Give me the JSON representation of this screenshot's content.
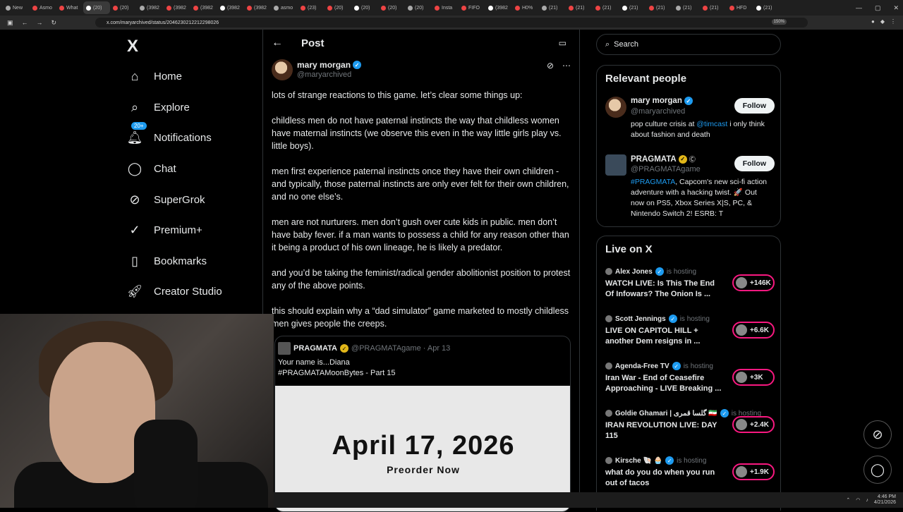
{
  "browser": {
    "tabs": [
      "New",
      "Asmo",
      "What",
      "(20)",
      "(20)",
      "(3982",
      "(3982",
      "(3982",
      "(3982",
      "(3982",
      "asmo",
      "(23)",
      "(20)",
      "(20)",
      "(20)",
      "(20)",
      "Insta",
      "FIFO",
      "(3982",
      "H0%",
      "(21)",
      "(21)",
      "(21)",
      "(21)",
      "(21)",
      "(21)",
      "(21)",
      "HFD",
      "(21)"
    ],
    "url": "x.com/maryarchived/status/2046230212212298026",
    "zoom": "150%",
    "clock_time": "4:46 PM",
    "clock_date": "4/21/2026"
  },
  "nav": {
    "logo": "X",
    "notifications_badge": "20+",
    "items": [
      {
        "label": "Home",
        "icon": "home-icon"
      },
      {
        "label": "Explore",
        "icon": "search-icon"
      },
      {
        "label": "Notifications",
        "icon": "bell-icon"
      },
      {
        "label": "Chat",
        "icon": "chat-icon"
      },
      {
        "label": "SuperGrok",
        "icon": "grok-icon"
      },
      {
        "label": "Premium+",
        "icon": "premium-icon"
      },
      {
        "label": "Bookmarks",
        "icon": "bookmark-icon"
      },
      {
        "label": "Creator Studio",
        "icon": "rocket-icon"
      }
    ]
  },
  "post": {
    "header_title": "Post",
    "author_name": "mary morgan",
    "author_handle": "@maryarchived",
    "paragraphs": [
      "lots of strange reactions to this game. let’s clear some things up:",
      "childless men do not have paternal instincts the way that childless women have maternal instincts (we observe this even in the way little girls play vs. little boys).",
      "men first experience paternal instincts once they have their own children - and typically, those paternal instincts are only ever felt for their own children, and no one else’s.",
      "men are not nurturers. men don’t gush over cute kids in public. men don’t have baby fever. if a man wants to possess a child for any reason other than it being a product of his own lineage, he is likely a predator.",
      "and you’d be taking the feminist/radical gender abolitionist position to protest any of the above points.",
      "this should explain why a “dad simulator” game marketed to mostly childless men gives people the creeps."
    ],
    "quote": {
      "name": "PRAGMATA",
      "handle": "@PRAGMATAgame · Apr 13",
      "text_line1": "Your name is...Diana",
      "text_line2": "#PRAGMATAMoonBytes - Part 15",
      "media_date": "April 17, 2026",
      "media_sub": "Preorder Now"
    }
  },
  "right": {
    "search_placeholder": "Search",
    "relevant_title": "Relevant people",
    "people": [
      {
        "name": "mary morgan",
        "handle": "@maryarchived",
        "bio_pre": "pop culture crisis at ",
        "bio_link": "@timcast",
        "bio_post": " i only think about fashion and death",
        "follow": "Follow"
      },
      {
        "name": "PRAGMATA",
        "handle": "@PRAGMATAgame",
        "bio_pre": "",
        "bio_link": "#PRAGMATA",
        "bio_post": ", Capcom's new sci-fi action adventure with a hacking twist. 🚀 Out now on PS5, Xbox Series X|S, PC, & Nintendo Switch 2! ESRB: T",
        "follow": "Follow"
      }
    ],
    "live_title": "Live on X",
    "live": [
      {
        "host": "Alex Jones",
        "status": "is hosting",
        "title": "WATCH LIVE: Is This The End Of Infowars? The Onion Is ...",
        "count": "+146K"
      },
      {
        "host": "Scott Jennings",
        "status": "is hosting",
        "title": "LIVE ON CAPITOL HILL + another Dem resigns in ...",
        "count": "+6.6K"
      },
      {
        "host": "Agenda-Free TV",
        "status": "is hosting",
        "title": "Iran War - End of Ceasefire Approaching - LIVE Breaking ...",
        "count": "+3K"
      },
      {
        "host": "Goldie Ghamari | گلسا قمری 🇮🇷",
        "status": "is hosting",
        "title": "IRAN REVOLUTION LIVE: DAY 115",
        "count": "+2.4K"
      },
      {
        "host": "Kirsche 🐚 🧁",
        "status": "is hosting",
        "title": "what do you do when you run out of tacos",
        "count": "+1.9K"
      }
    ]
  }
}
